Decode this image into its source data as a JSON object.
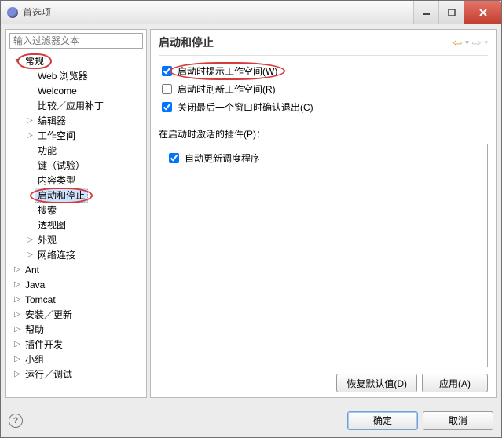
{
  "window": {
    "title": "首选项"
  },
  "filter": {
    "placeholder": "输入过滤器文本"
  },
  "tree": {
    "general": "常规",
    "items1": [
      {
        "label": "Web 浏览器",
        "exp": ""
      },
      {
        "label": "Welcome",
        "exp": ""
      },
      {
        "label": "比较／应用补丁",
        "exp": ""
      },
      {
        "label": "编辑器",
        "exp": "▷"
      },
      {
        "label": "工作空间",
        "exp": "▷"
      },
      {
        "label": "功能",
        "exp": ""
      },
      {
        "label": "键（试验）",
        "exp": ""
      },
      {
        "label": "内容类型",
        "exp": ""
      }
    ],
    "selected": "启动和停止",
    "items2": [
      {
        "label": "搜索",
        "exp": ""
      },
      {
        "label": "透视图",
        "exp": ""
      },
      {
        "label": "外观",
        "exp": "▷"
      },
      {
        "label": "网络连接",
        "exp": "▷"
      }
    ],
    "tops": [
      {
        "label": "Ant",
        "exp": "▷"
      },
      {
        "label": "Java",
        "exp": "▷"
      },
      {
        "label": "Tomcat",
        "exp": "▷"
      },
      {
        "label": "安装／更新",
        "exp": "▷"
      },
      {
        "label": "帮助",
        "exp": "▷"
      },
      {
        "label": "插件开发",
        "exp": "▷"
      },
      {
        "label": "小组",
        "exp": "▷"
      },
      {
        "label": "运行／调试",
        "exp": "▷"
      }
    ]
  },
  "main": {
    "title": "启动和停止",
    "checks": {
      "prompt_workspace": "启动时提示工作空间(W)",
      "refresh_workspace": "启动时刷新工作空间(R)",
      "confirm_exit": "关闭最后一个窗口时确认退出(C)"
    },
    "plugins_label": "在启动时激活的插件(P)：",
    "plugin1": "自动更新调度程序",
    "restore_defaults": "恢复默认值(D)",
    "apply": "应用(A)"
  },
  "footer": {
    "ok": "确定",
    "cancel": "取消"
  }
}
